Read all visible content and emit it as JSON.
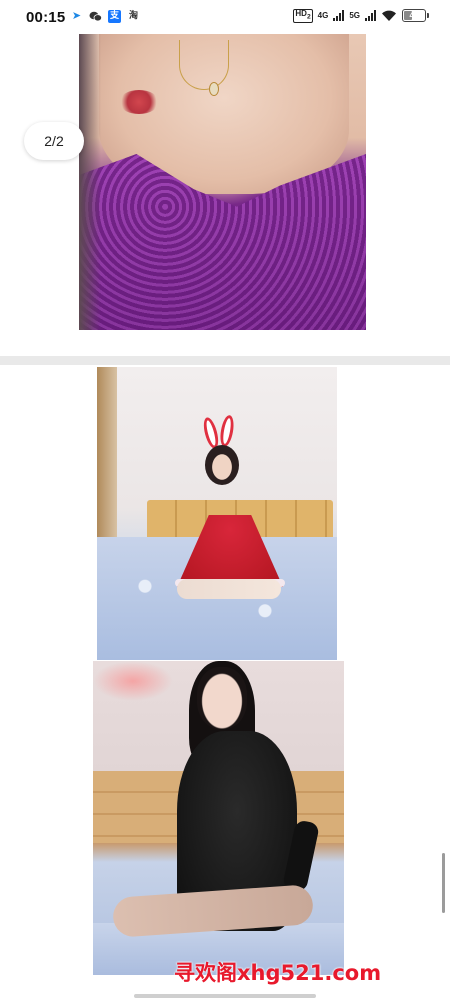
{
  "status_bar": {
    "time": "00:15",
    "app_icons": [
      "bird-icon",
      "wechat-icon",
      "alipay-icon",
      "taobao-icon"
    ],
    "alipay_glyph": "支",
    "taobao_glyph": "淘",
    "hd_label": "HD",
    "hd_sub": "2",
    "network_1": "4G",
    "network_2": "5G",
    "battery_level": "47",
    "battery_fraction": 0.47
  },
  "gallery": {
    "page_indicator": "2/2"
  },
  "watermark": {
    "text": "寻欢阁xhg521.com",
    "color": "#e8192c"
  },
  "colors": {
    "background": "#ffffff",
    "divider": "#e9e9e9"
  }
}
